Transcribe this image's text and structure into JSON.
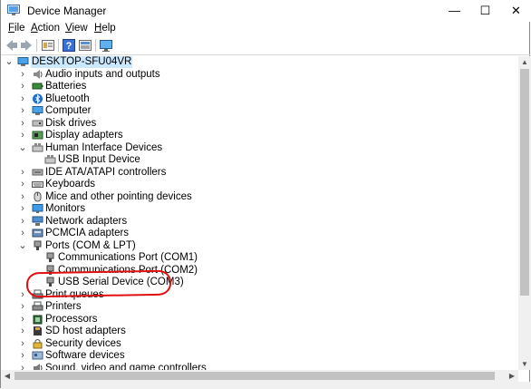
{
  "window": {
    "title": "Device Manager",
    "controls": {
      "minimize": "—",
      "maximize": "☐",
      "close": "✕"
    }
  },
  "menu": {
    "items": [
      {
        "accel": "F",
        "rest": "ile"
      },
      {
        "accel": "A",
        "rest": "ction"
      },
      {
        "accel": "V",
        "rest": "iew"
      },
      {
        "accel": "H",
        "rest": "elp"
      }
    ]
  },
  "toolbar": {
    "buttons": [
      "back-icon",
      "forward-icon",
      "properties-icon",
      "help-icon",
      "show-hidden-icon",
      "monitor-icon"
    ]
  },
  "tree": {
    "root": {
      "label": "DESKTOP-SFU04VR",
      "expanded": true
    },
    "categories": [
      {
        "label": "Audio inputs and outputs",
        "icon": "speaker-icon",
        "expanded": false
      },
      {
        "label": "Batteries",
        "icon": "battery-icon",
        "expanded": false
      },
      {
        "label": "Bluetooth",
        "icon": "bluetooth-icon",
        "expanded": false
      },
      {
        "label": "Computer",
        "icon": "computer-icon",
        "expanded": false
      },
      {
        "label": "Disk drives",
        "icon": "disk-icon",
        "expanded": false
      },
      {
        "label": "Display adapters",
        "icon": "display-adapter-icon",
        "expanded": false
      },
      {
        "label": "Human Interface Devices",
        "icon": "hid-icon",
        "expanded": true,
        "children": [
          {
            "label": "USB Input Device",
            "icon": "hid-icon"
          }
        ]
      },
      {
        "label": "IDE ATA/ATAPI controllers",
        "icon": "ide-icon",
        "expanded": false
      },
      {
        "label": "Keyboards",
        "icon": "keyboard-icon",
        "expanded": false
      },
      {
        "label": "Mice and other pointing devices",
        "icon": "mouse-icon",
        "expanded": false
      },
      {
        "label": "Monitors",
        "icon": "monitor-icon",
        "expanded": false
      },
      {
        "label": "Network adapters",
        "icon": "network-icon",
        "expanded": false
      },
      {
        "label": "PCMCIA adapters",
        "icon": "pcmcia-icon",
        "expanded": false
      },
      {
        "label": "Ports (COM & LPT)",
        "icon": "port-icon",
        "expanded": true,
        "children": [
          {
            "label": "Communications Port (COM1)",
            "icon": "port-icon"
          },
          {
            "label": "Communications Port (COM2)",
            "icon": "port-icon"
          },
          {
            "label": "USB Serial Device (COM3)",
            "icon": "port-icon"
          }
        ]
      },
      {
        "label": "Print queues",
        "icon": "printer-icon",
        "expanded": false
      },
      {
        "label": "Printers",
        "icon": "printer-icon",
        "expanded": false
      },
      {
        "label": "Processors",
        "icon": "processor-icon",
        "expanded": false
      },
      {
        "label": "SD host adapters",
        "icon": "sd-icon",
        "expanded": false
      },
      {
        "label": "Security devices",
        "icon": "security-icon",
        "expanded": false
      },
      {
        "label": "Software devices",
        "icon": "software-icon",
        "expanded": false
      },
      {
        "label": "Sound, video and game controllers",
        "icon": "sound-icon",
        "expanded": false
      }
    ]
  },
  "colors": {
    "selection": "#cce8ff",
    "annotation": "#e01010",
    "folder_blue": "#2b79d6"
  }
}
